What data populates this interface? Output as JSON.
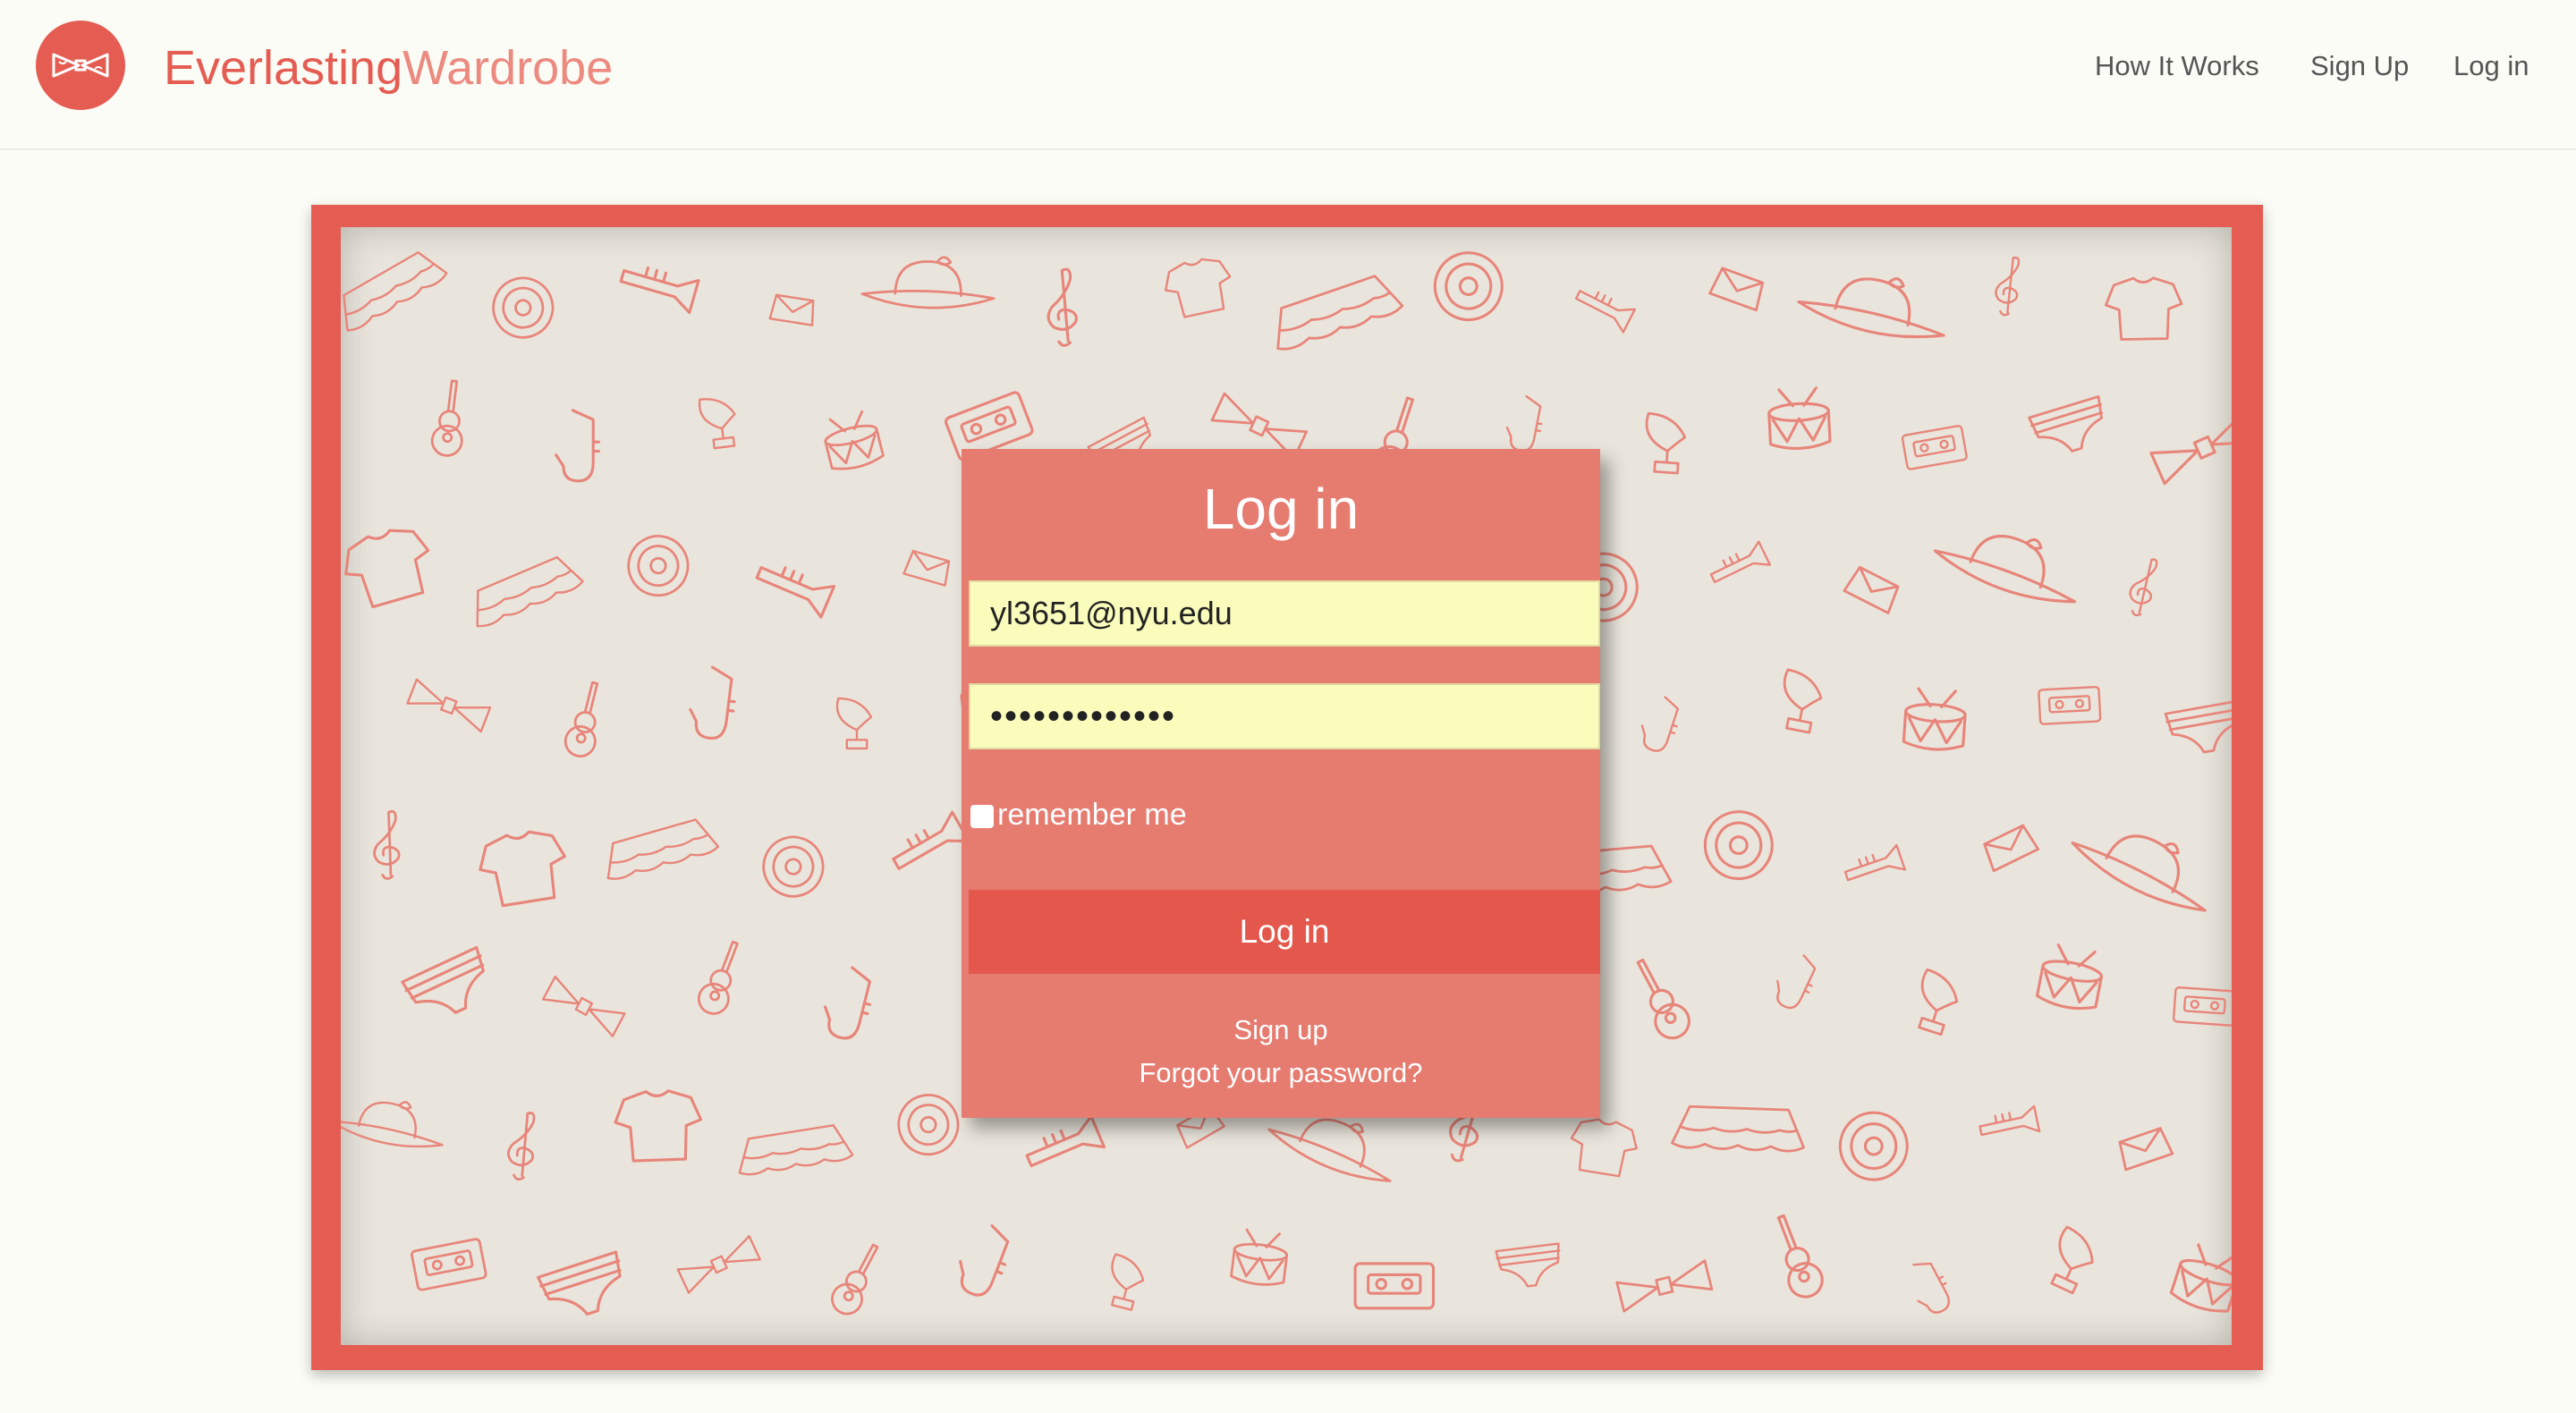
{
  "header": {
    "brand_part1": "Everlasting",
    "brand_part2": "Wardrobe",
    "nav": [
      "How It Works",
      "Sign Up",
      "Log in"
    ]
  },
  "login": {
    "title": "Log in",
    "email_value": "yl3651@nyu.edu",
    "password_value": "•••••••••••••",
    "remember_label": "remember me",
    "remember_checked": false,
    "submit_label": "Log in",
    "signup_link": "Sign up",
    "forgot_link": "Forgot your password?"
  },
  "colors": {
    "brand": "#e45c52",
    "card": "#e67b70",
    "button": "#e4574d",
    "field": "#fafcbc",
    "pattern_bg": "#e9e5dc",
    "pattern_ink": "#e8857a"
  },
  "icons": {
    "logo": "bow-tie-logo-icon",
    "pattern": [
      "skirt-icon",
      "bow-icon",
      "hat-icon",
      "drum-icon",
      "vinyl-record-icon",
      "guitar-icon",
      "treble-clef-icon",
      "cassette-icon",
      "trumpet-icon",
      "saxophone-icon",
      "shirt-icon",
      "underwear-icon",
      "purse-icon",
      "gramophone-icon"
    ]
  }
}
